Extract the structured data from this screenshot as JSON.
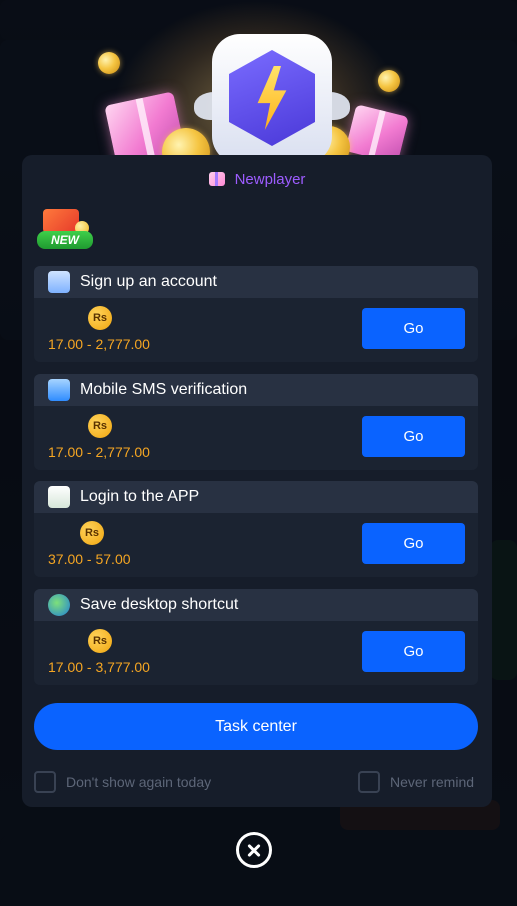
{
  "popup": {
    "title": "Newplayer",
    "new_badge": "NEW",
    "currency_symbol": "Rs",
    "go_label": "Go",
    "tasks": [
      {
        "name": "Sign up an account",
        "range": "17.00 - 2,777.00",
        "icon": "clipboard-check-icon"
      },
      {
        "name": "Mobile SMS verification",
        "range": "17.00 - 2,777.00",
        "icon": "phone-shield-icon"
      },
      {
        "name": "Login to the APP",
        "range": "37.00 - 57.00",
        "icon": "login-arrow-icon"
      },
      {
        "name": "Save desktop shortcut",
        "range": "17.00 - 3,777.00",
        "icon": "globe-icon"
      }
    ],
    "task_center_label": "Task center",
    "dont_show_today": "Don't show again today",
    "never_remind": "Never remind"
  },
  "colors": {
    "accent_blue": "#0a63ff",
    "title_purple": "#9d5cff",
    "amount_orange": "#f5a623",
    "modal_bg": "#161d2a"
  }
}
